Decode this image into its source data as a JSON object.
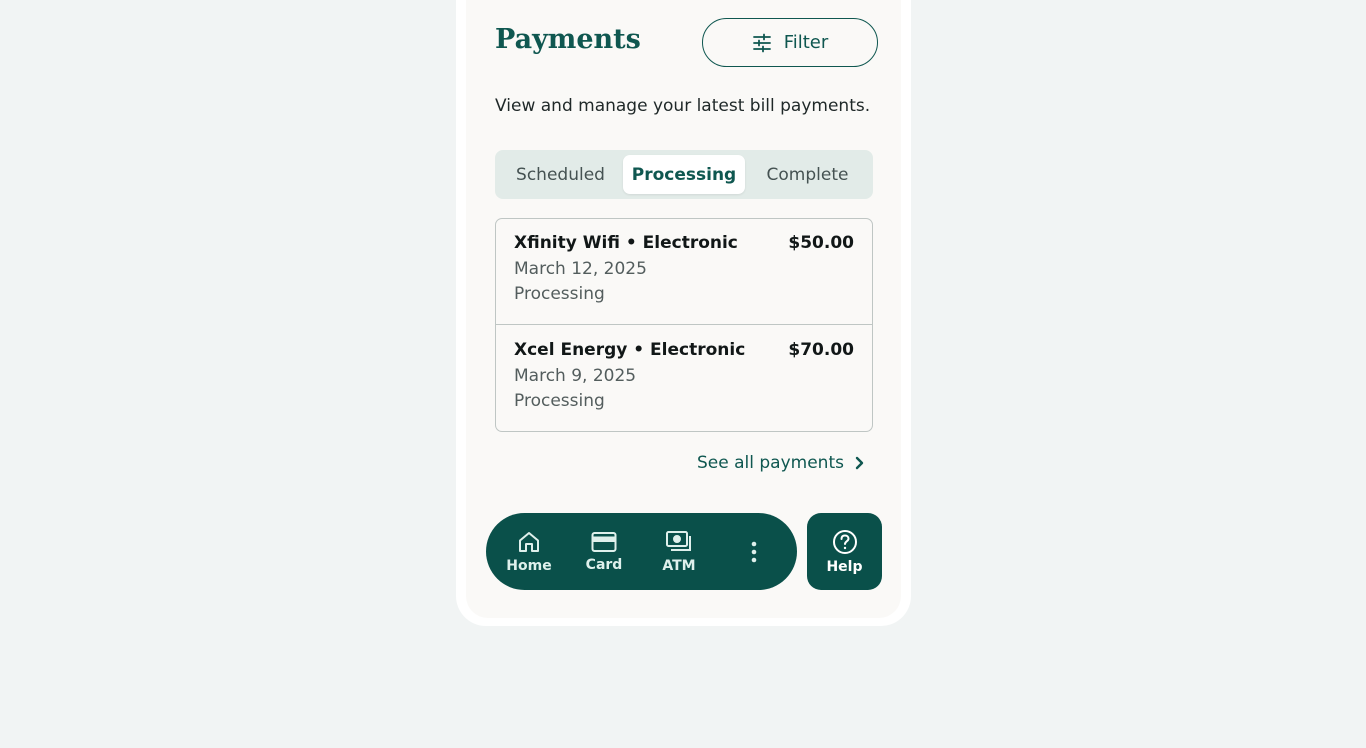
{
  "header": {
    "title": "Payments",
    "filter_label": "Filter"
  },
  "subtitle": "View and manage your latest bill payments.",
  "tabs": [
    {
      "label": "Scheduled",
      "active": false
    },
    {
      "label": "Processing",
      "active": true
    },
    {
      "label": "Complete",
      "active": false
    }
  ],
  "payments": [
    {
      "payee": "Xfinity Wifi • Electronic",
      "amount": "$50.00",
      "date": "March 12, 2025",
      "status": "Processing"
    },
    {
      "payee": "Xcel Energy • Electronic",
      "amount": "$70.00",
      "date": "March 9, 2025",
      "status": "Processing"
    }
  ],
  "see_all_label": "See all payments",
  "nav": {
    "items": [
      {
        "label": "Home",
        "icon": "home-icon"
      },
      {
        "label": "Card",
        "icon": "card-icon"
      },
      {
        "label": "ATM",
        "icon": "atm-icon"
      },
      {
        "label": "",
        "icon": "more-vertical-icon"
      }
    ],
    "help_label": "Help"
  },
  "colors": {
    "brand": "#0f5750",
    "nav_background": "#0a504a",
    "page_background": "#f1f4f4",
    "tab_track": "#e2ebe8"
  }
}
